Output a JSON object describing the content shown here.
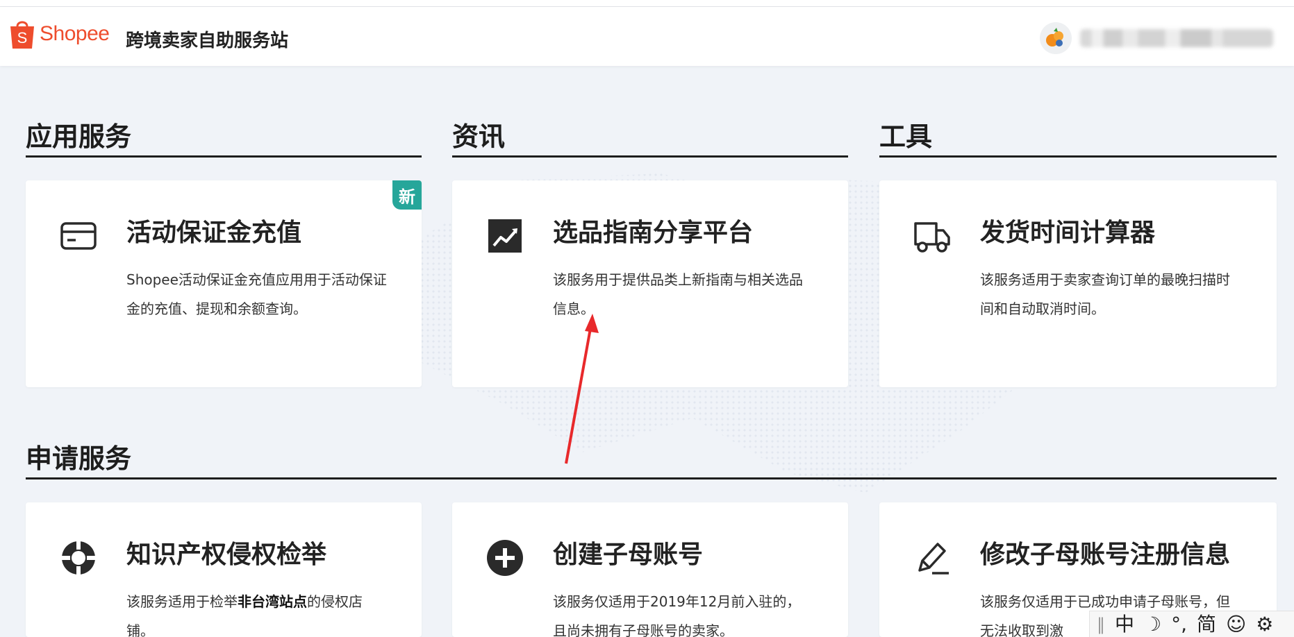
{
  "header": {
    "brand": "Shopee",
    "site_title": "跨境卖家自助服务站"
  },
  "sections": [
    {
      "title": "应用服务"
    },
    {
      "title": "资讯"
    },
    {
      "title": "工具"
    },
    {
      "title": "申请服务"
    }
  ],
  "cards": {
    "deposit": {
      "title": "活动保证金充值",
      "desc": "Shopee活动保证金充值应用用于活动保证金的充值、提现和余额查询。",
      "badge": "新",
      "icon": "credit-card-icon"
    },
    "guide": {
      "title": "选品指南分享平台",
      "desc": "该服务用于提供品类上新指南与相关选品信息。",
      "icon": "trend-chart-icon"
    },
    "shipping": {
      "title": "发货时间计算器",
      "desc": "该服务适用于卖家查询订单的最晚扫描时间和自动取消时间。",
      "icon": "truck-icon"
    },
    "ip": {
      "title": "知识产权侵权检举",
      "desc_prefix": "该服务适用于检举",
      "desc_bold": "非台湾站点",
      "desc_suffix": "的侵权店铺。",
      "icon": "lifebuoy-icon"
    },
    "create_account": {
      "title": "创建子母账号",
      "desc": "该服务仅适用于2019年12月前入驻的，且尚未拥有子母账号的卖家。",
      "icon": "plus-circle-icon"
    },
    "modify_account": {
      "title": "修改子母账号注册信息",
      "desc": "该服务仅适用于已成功申请子母账号，但无法收取到激",
      "icon": "pencil-icon"
    }
  },
  "ime": {
    "items": [
      "中",
      "☽",
      "°,",
      "简",
      "☺",
      "⚙"
    ]
  },
  "colors": {
    "brand": "#ee4d2d",
    "badge": "#26a69a",
    "annotation_arrow": "#e8292b",
    "background": "#f0f3f8"
  }
}
